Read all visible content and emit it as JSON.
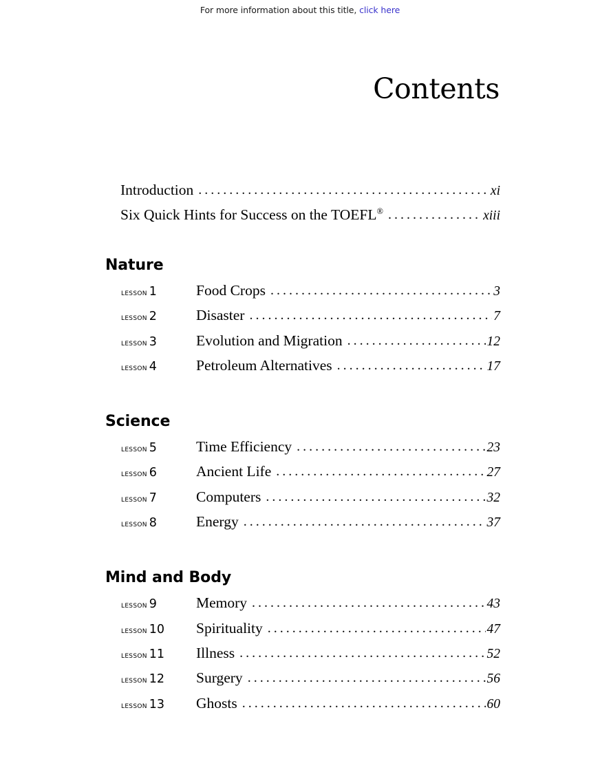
{
  "header": {
    "prefix": "For more information about this title,",
    "link_text": "click here",
    "link_color": "#3a33cc"
  },
  "page_title": "Contents",
  "front_matter": [
    {
      "label": "Introduction",
      "trademark": "",
      "page": "xi"
    },
    {
      "label": "Six Quick Hints for Success on the TOEFL",
      "trademark": "®",
      "page": "xiii"
    }
  ],
  "sections": [
    {
      "heading": "Nature",
      "lessons": [
        {
          "tag": "LESSON",
          "number": "1",
          "title": "Food Crops",
          "page": "3"
        },
        {
          "tag": "LESSON",
          "number": "2",
          "title": "Disaster",
          "page": "7"
        },
        {
          "tag": "LESSON",
          "number": "3",
          "title": "Evolution and Migration",
          "page": "12"
        },
        {
          "tag": "LESSON",
          "number": "4",
          "title": "Petroleum Alternatives",
          "page": "17"
        }
      ]
    },
    {
      "heading": "Science",
      "lessons": [
        {
          "tag": "LESSON",
          "number": "5",
          "title": "Time Efficiency",
          "page": "23"
        },
        {
          "tag": "LESSON",
          "number": "6",
          "title": "Ancient Life",
          "page": "27"
        },
        {
          "tag": "LESSON",
          "number": "7",
          "title": "Computers",
          "page": "32"
        },
        {
          "tag": "LESSON",
          "number": "8",
          "title": "Energy",
          "page": "37"
        }
      ]
    },
    {
      "heading": "Mind and Body",
      "lessons": [
        {
          "tag": "LESSON",
          "number": "9",
          "title": "Memory",
          "page": "43"
        },
        {
          "tag": "LESSON",
          "number": "10",
          "title": "Spirituality",
          "page": "47"
        },
        {
          "tag": "LESSON",
          "number": "11",
          "title": "Illness",
          "page": "52"
        },
        {
          "tag": "LESSON",
          "number": "12",
          "title": "Surgery",
          "page": "56"
        },
        {
          "tag": "LESSON",
          "number": "13",
          "title": "Ghosts",
          "page": "60"
        }
      ]
    }
  ]
}
